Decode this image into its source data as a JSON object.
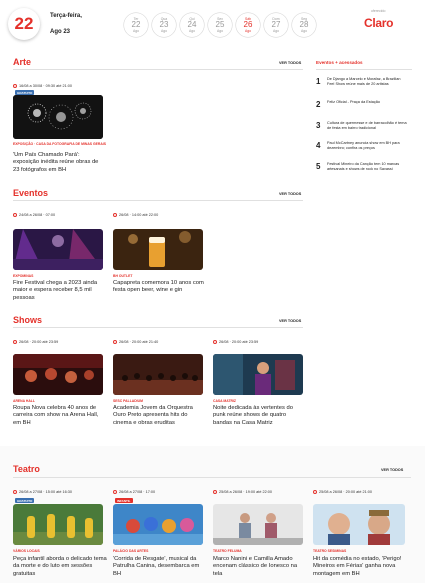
{
  "header": {
    "day_number": "22",
    "weekday": "Terça-feira,",
    "month_day": "Ago 23",
    "days": [
      {
        "w": "Ter",
        "n": "22",
        "m": "Ago",
        "active": false
      },
      {
        "w": "Qua",
        "n": "23",
        "m": "Ago",
        "active": false
      },
      {
        "w": "Qui",
        "n": "24",
        "m": "Ago",
        "active": false
      },
      {
        "w": "Sex",
        "n": "25",
        "m": "Ago",
        "active": false
      },
      {
        "w": "Sáb",
        "n": "26",
        "m": "Ago",
        "active": true
      },
      {
        "w": "Dom",
        "n": "27",
        "m": "Ago",
        "active": false
      },
      {
        "w": "Seg",
        "n": "28",
        "m": "Ago",
        "active": false
      }
    ],
    "sponsor_by": "oferecido",
    "sponsor_logo": "Claro"
  },
  "arte": {
    "title": "Arte",
    "see_all": "VER TODOS",
    "card": {
      "when": "16/08 a 30/08 · 09:30 até 21:00",
      "badge": "GRATUITO",
      "category": "EXPOSIÇÃO · CASA DA FOTOGRAFIA DE MINAS GERAIS",
      "title": "'Um País Chamado Pará': exposição inédita reúne obras de 23 fotógrafos em BH"
    }
  },
  "eventos": {
    "title": "Eventos",
    "see_all": "VER TODOS",
    "cards": [
      {
        "when": "24/08 a 26/08 · 07:00",
        "category": "EXPOMINAS",
        "title": "Fire Festival chega a 2023 ainda maior e espera receber 8,5 mil pessoas"
      },
      {
        "when": "26/08 · 14:00 até 22:00",
        "category": "BH OUTLET",
        "title": "Capapreta comemora 10 anos com festa open beer, wine e gin"
      }
    ]
  },
  "shows": {
    "title": "Shows",
    "see_all": "VER TODOS",
    "cards": [
      {
        "when": "26/08 · 20:00 até 23:59",
        "category": "ARENA HALL",
        "title": "Roupa Nova celebra 40 anos de carreira com show na Arena Hall, em BH"
      },
      {
        "when": "26/08 · 20:00 até 21:40",
        "category": "SESC PALLADIUM",
        "title": "Academia Jovem da Orquestra Ouro Preto apresenta hits do cinema e obras eruditas"
      },
      {
        "when": "26/08 · 20:00 até 23:59",
        "category": "CASA MATRIZ",
        "title": "Noite dedicada às vertentes do punk reúne shows de quatro bandas na Casa Matriz"
      }
    ]
  },
  "teatro": {
    "title": "Teatro",
    "see_all": "VER TODOS",
    "cards": [
      {
        "when": "26/08 a 27/08 · 15:00 até 16:30",
        "badge": "GRATUITO",
        "category": "VÁRIOS LOCAIS",
        "title": "Peça infantil aborda o delicado tema da morte e do luto em sessões gratuitas"
      },
      {
        "when": "26/08 a 27/08 · 17:00",
        "badge": "INFANTIL",
        "category": "PALÁCIO DAS ARTES",
        "title": "'Corrida de Resgate', musical da Patrulha Canina, desembarca em BH"
      },
      {
        "when": "25/08 a 26/08 · 19:00 até 22:00",
        "category": "TEATRO FELUMA",
        "title": "Marco Nanini e Camilla Amado encenam clássico de Ionesco na tela"
      },
      {
        "when": "25/08 a 26/08 · 20:00 até 21:00",
        "category": "TEATRO SESIMINAS",
        "title": "Hit da comédia no estado, 'Perigo! Mineiros em Férias' ganha nova montagem em BH"
      }
    ]
  },
  "sidebar": {
    "title": "Eventos + acessados",
    "items": [
      {
        "num": "1",
        "text": "De Django a Marcelo e Morafaz, a Brazilian Feel Show reúne mais de 20 artistas"
      },
      {
        "num": "2",
        "text": "Feliz Oficial - Praça da Estação"
      },
      {
        "num": "3",
        "text": "Cultura de quermesse e de barracolhão é tema de festa em bairro tradicional"
      },
      {
        "num": "4",
        "text": "Paul McCartney anuncia show em BH para dezembro; confira os preços"
      },
      {
        "num": "5",
        "text": "Festival Mineiro da Canção tem 10 marcas artesanais e shows de rock no Savassi"
      }
    ]
  },
  "colors": {
    "accent": "#e4312b",
    "badge_blue": "#3a6fb0"
  }
}
